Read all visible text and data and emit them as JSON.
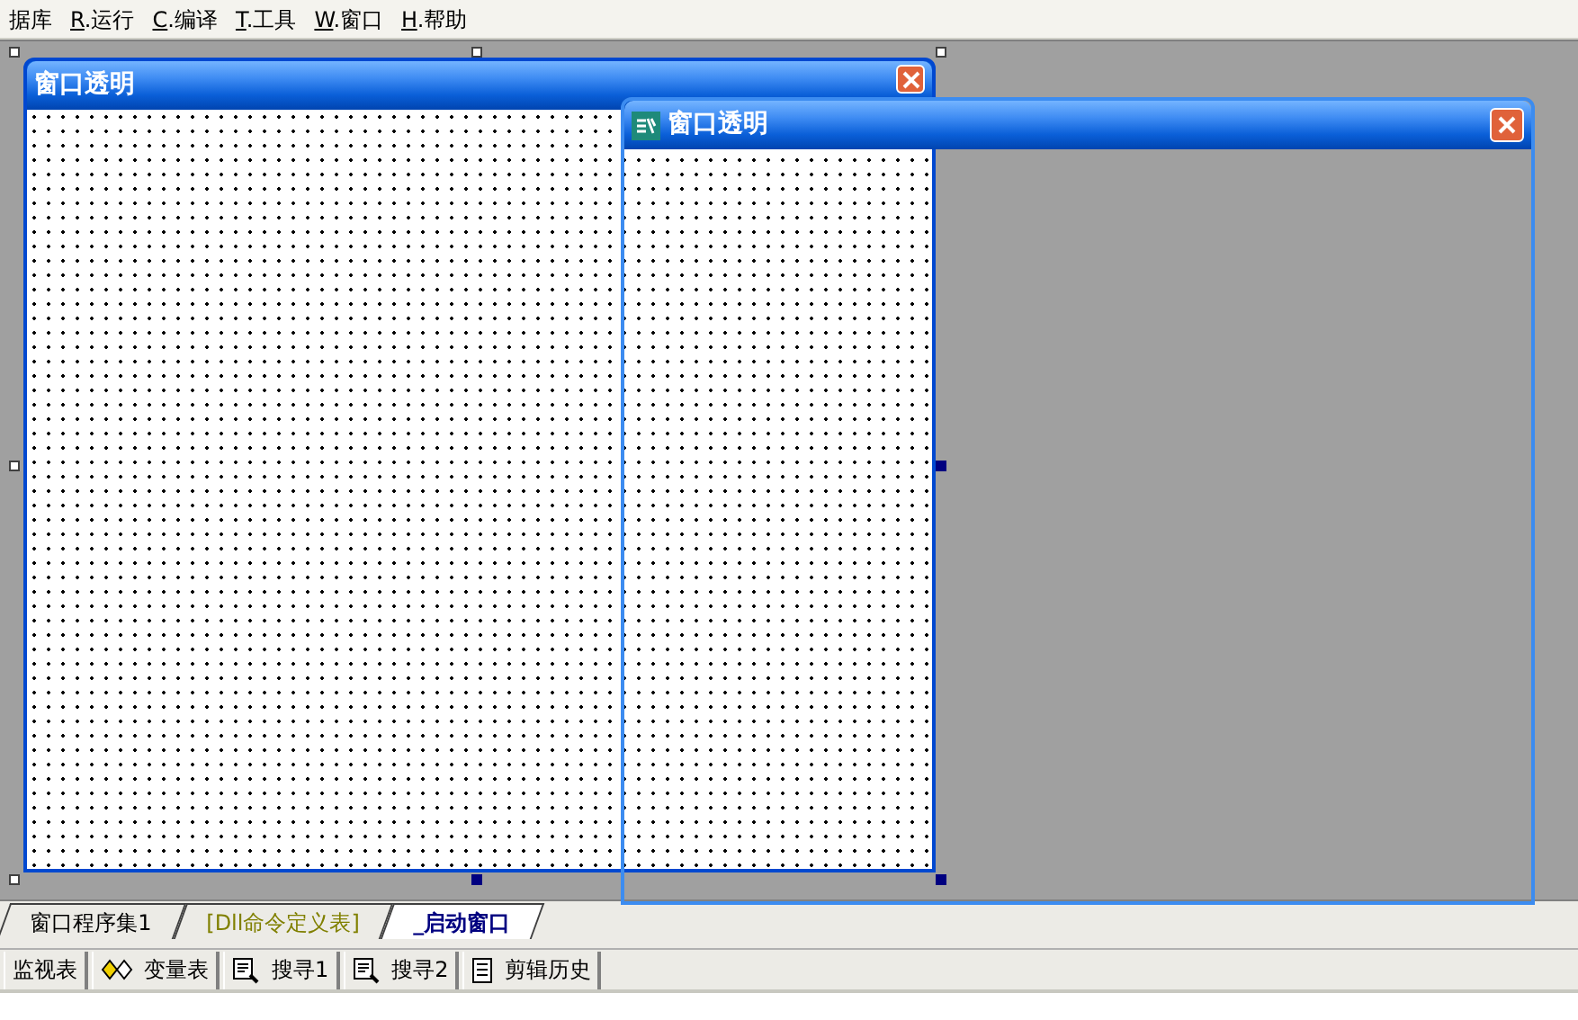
{
  "menu": [
    {
      "label": "据库",
      "underlined": false
    },
    {
      "label": "R.运行",
      "underlined": true
    },
    {
      "label": "C.编译",
      "underlined": true
    },
    {
      "label": "T.工具",
      "underlined": true
    },
    {
      "label": "W.窗口",
      "underlined": true
    },
    {
      "label": "H.帮助",
      "underlined": true
    }
  ],
  "design_window": {
    "title": "窗口透明",
    "selected": true
  },
  "running_window": {
    "title": "窗口透明"
  },
  "tabs": [
    {
      "label": "窗口程序集1",
      "kind": "program",
      "selected": false
    },
    {
      "label": "[Dll命令定义表]",
      "kind": "dll",
      "selected": false
    },
    {
      "label": "_启动窗口",
      "kind": "window",
      "selected": true
    }
  ],
  "panels": [
    {
      "label": "监视表",
      "kind": "plain"
    },
    {
      "label": "变量表",
      "kind": "vars"
    },
    {
      "label": "搜寻1",
      "kind": "search"
    },
    {
      "label": "搜寻2",
      "kind": "search"
    },
    {
      "label": "剪辑历史",
      "kind": "history"
    }
  ]
}
